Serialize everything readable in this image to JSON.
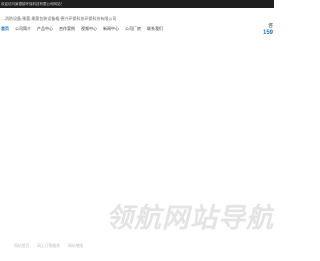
{
  "topbar": {
    "text": "欢迎访问景德镇环保科技有限公司网站！"
  },
  "header": {
    "tagline": "…消防设备,果蔬,果蔬包装设备格,德兴环保科技环保科技有限公司",
    "phone_label": "咨",
    "phone_number": "159"
  },
  "nav": {
    "items": [
      {
        "label": "首页",
        "active": true
      },
      {
        "label": "公司简介",
        "active": false
      },
      {
        "label": "产品中心",
        "active": false
      },
      {
        "label": "合作案例",
        "active": false
      },
      {
        "label": "视频中心",
        "active": false
      },
      {
        "label": "新闻中心",
        "active": false
      },
      {
        "label": "公司厂房",
        "active": false
      },
      {
        "label": "联系我们",
        "active": false
      }
    ]
  },
  "footer": {
    "links": [
      "网站首页",
      "网上订购服务",
      "网站地图"
    ]
  },
  "watermark": {
    "text": "领航网站导航"
  }
}
